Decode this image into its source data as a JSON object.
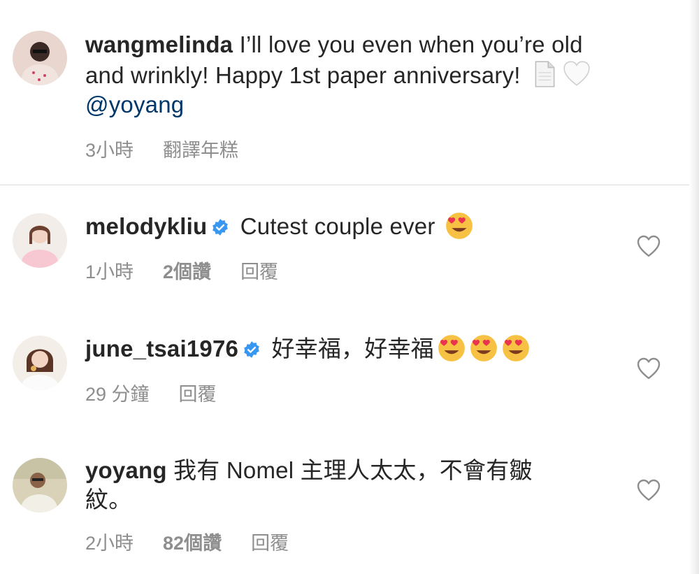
{
  "caption": {
    "username": "wangmelinda",
    "text_line1": " I’ll love you even when you’re old",
    "text_line2": "and wrinkly! Happy 1st paper anniversary! ",
    "mention": "@yoyang",
    "time": "3小時",
    "translate": "翻譯年糕",
    "emojis": [
      "page-emoji",
      "white-heart-emoji"
    ]
  },
  "comments": [
    {
      "username": "melodykliu",
      "verified": true,
      "text": " Cutest couple ever ",
      "emojis": [
        "heart-eyes-emoji"
      ],
      "time": "1小時",
      "likes": "2個讚",
      "reply": "回覆"
    },
    {
      "username": "june_tsai1976",
      "verified": true,
      "text": " 好幸福，好幸福",
      "emojis": [
        "heart-eyes-emoji",
        "heart-eyes-emoji",
        "heart-eyes-emoji"
      ],
      "time": "29 分鐘",
      "reply": "回覆"
    },
    {
      "username": "yoyang",
      "verified": false,
      "text_line1": " 我有 Nomel 主理人太太，不會有皺",
      "text_line2": "紋。",
      "time": "2小時",
      "likes": "82個讚",
      "reply": "回覆"
    }
  ],
  "colors": {
    "text": "#262626",
    "meta": "#8e8e8e",
    "mention": "#00376b",
    "verified": "#3897f0",
    "divider": "#dbdbdb"
  }
}
